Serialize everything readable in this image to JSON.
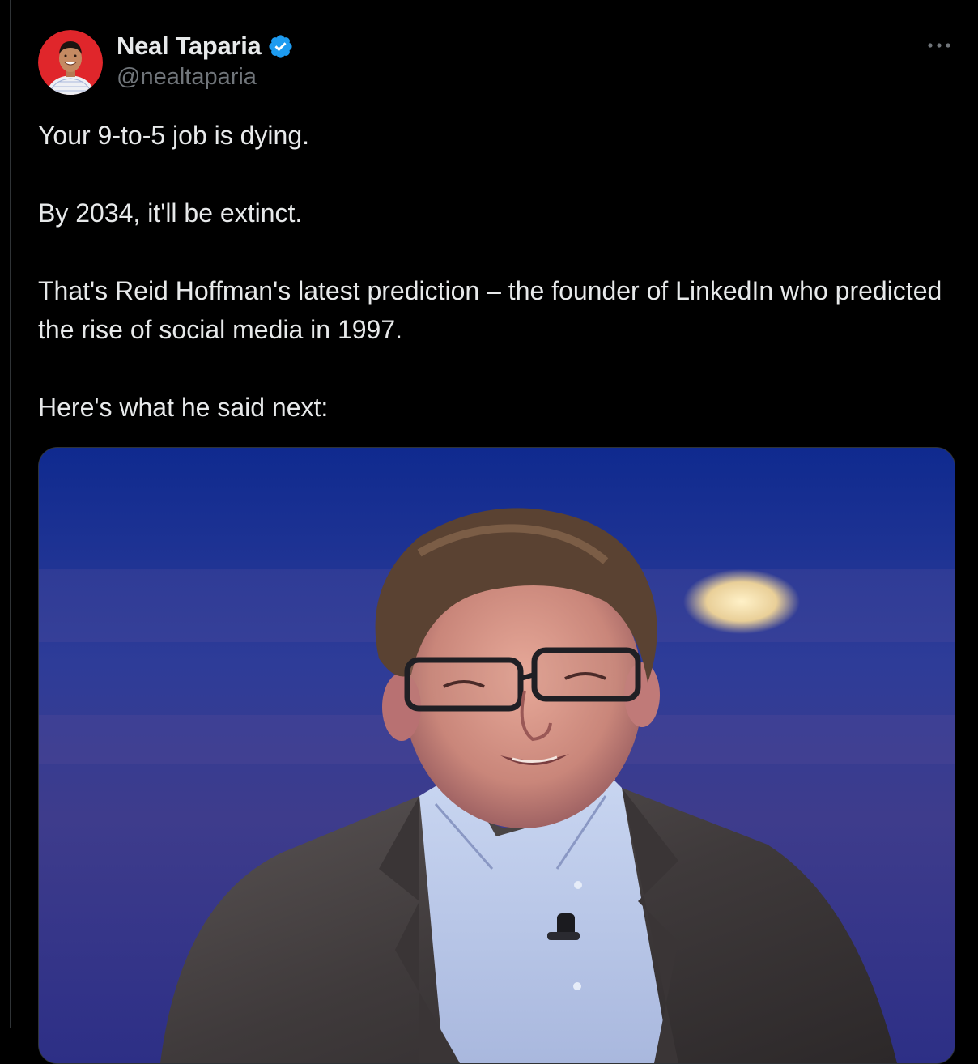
{
  "tweet": {
    "author": {
      "display_name": "Neal Taparia",
      "handle": "@nealtaparia",
      "verified": true
    },
    "paragraphs": [
      "Your 9-to-5 job is dying.",
      "By 2034, it'll be extinct.",
      "That's Reid Hoffman's latest prediction – the founder of LinkedIn who predicted the rise of social media in 1997.",
      "Here's what he said next:"
    ],
    "icons": {
      "verified": "verified-badge-icon",
      "more": "more-options-icon"
    },
    "colors": {
      "background": "#000000",
      "text": "#e7e9ea",
      "secondary_text": "#71767b",
      "verified_blue": "#1d9bf0",
      "avatar_bg": "#e0262b",
      "border": "#2f3336"
    }
  }
}
